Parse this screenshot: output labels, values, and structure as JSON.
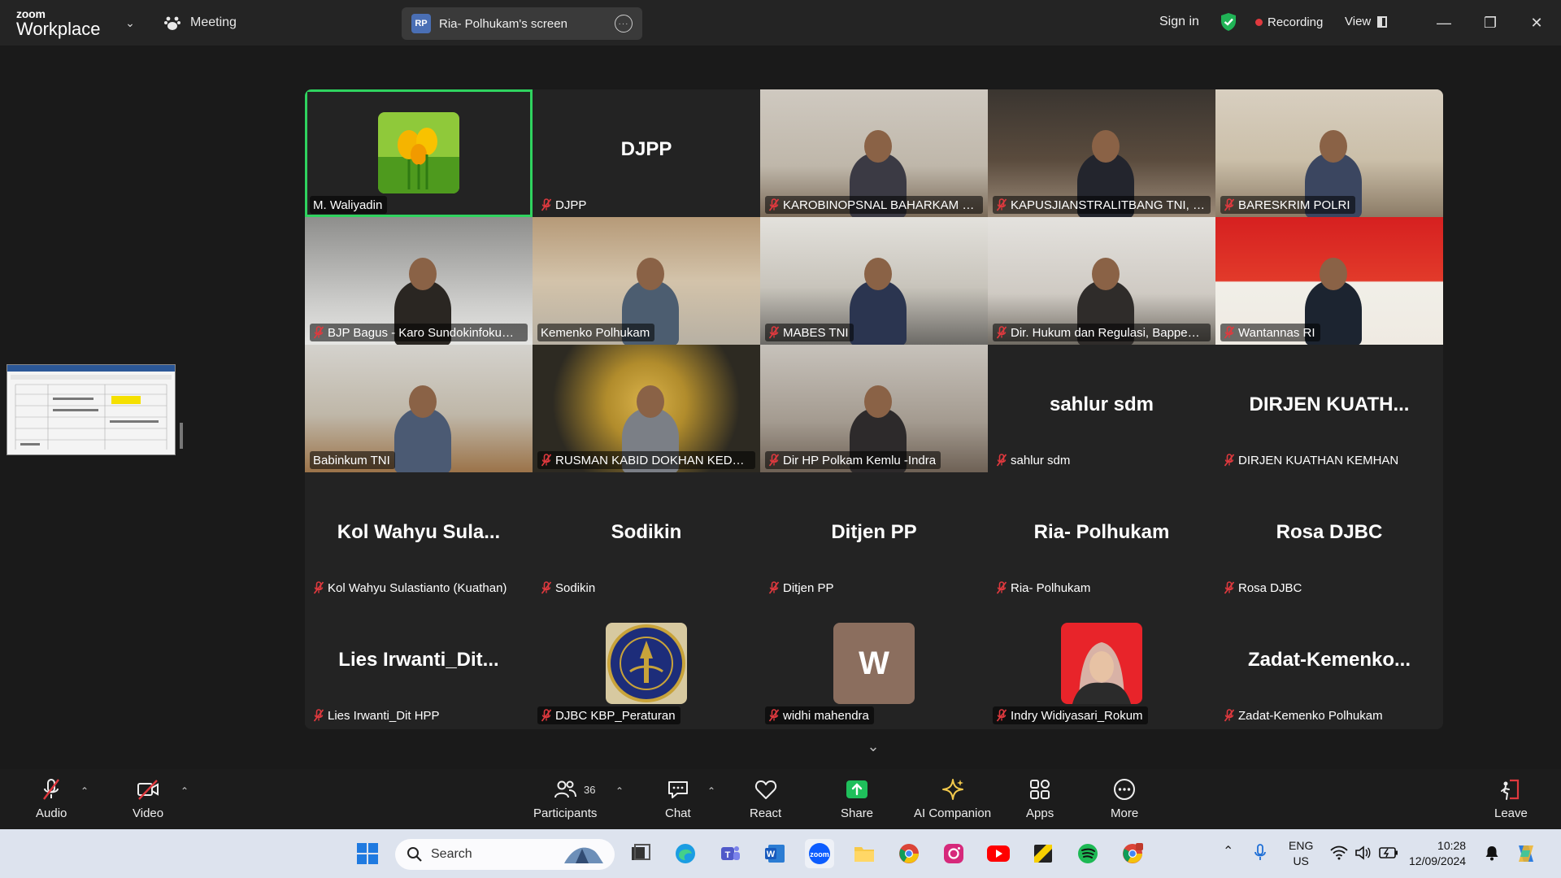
{
  "app": {
    "brand_top": "zoom",
    "brand_bottom": "Workplace",
    "meeting_label": "Meeting",
    "screen_share_badge": "RP",
    "screen_share_label": "Ria- Polhukam's screen",
    "sign_in": "Sign in",
    "recording": "Recording",
    "view": "View"
  },
  "participants": [
    {
      "name": "M. Waliyadin",
      "display": "",
      "type": "avatar-image",
      "muted": false,
      "active": true
    },
    {
      "name": "DJPP",
      "display": "DJPP",
      "type": "name",
      "muted": true
    },
    {
      "name": "KAROBINOPSNAL BAHARKAM PO...",
      "display": "",
      "type": "video",
      "muted": true
    },
    {
      "name": "KAPUSJIANSTRALITBANG TNI, Ma...",
      "display": "",
      "type": "video",
      "muted": true
    },
    {
      "name": "BARESKRIM POLRI",
      "display": "",
      "type": "video",
      "muted": true
    },
    {
      "name": "BJP Bagus - Karo Sundokinfokum ...",
      "display": "",
      "type": "video",
      "muted": true
    },
    {
      "name": "Kemenko Polhukam",
      "display": "",
      "type": "video",
      "muted": false
    },
    {
      "name": "MABES TNI",
      "display": "",
      "type": "video",
      "muted": true
    },
    {
      "name": "Dir. Hukum dan Regulasi, Bappena...",
      "display": "",
      "type": "video",
      "muted": true
    },
    {
      "name": "Wantannas RI",
      "display": "",
      "type": "video",
      "muted": true
    },
    {
      "name": "Babinkum TNI",
      "display": "",
      "type": "video",
      "muted": false
    },
    {
      "name": "RUSMAN KABID DOKHAN KEDEP...",
      "display": "",
      "type": "video",
      "muted": true
    },
    {
      "name": "Dir HP Polkam Kemlu -Indra",
      "display": "",
      "type": "video",
      "muted": true
    },
    {
      "name": "sahlur sdm",
      "display": "sahlur sdm",
      "type": "name",
      "muted": true
    },
    {
      "name": "DIRJEN KUATHAN KEMHAN",
      "display": "DIRJEN  KUATH...",
      "type": "name",
      "muted": true
    },
    {
      "name": "Kol Wahyu Sulastianto (Kuathan)",
      "display": "Kol  Wahyu  Sula...",
      "type": "name",
      "muted": true
    },
    {
      "name": "Sodikin",
      "display": "Sodikin",
      "type": "name",
      "muted": true
    },
    {
      "name": "Ditjen PP",
      "display": "Ditjen PP",
      "type": "name",
      "muted": true
    },
    {
      "name": "Ria- Polhukam",
      "display": "Ria- Polhukam",
      "type": "name",
      "muted": true
    },
    {
      "name": "Rosa DJBC",
      "display": "Rosa DJBC",
      "type": "name",
      "muted": true
    },
    {
      "name": "Lies Irwanti_Dit HPP",
      "display": "Lies  Irwanti_Dit...",
      "type": "name",
      "muted": true
    },
    {
      "name": "DJBC KBP_Peraturan",
      "display": "",
      "type": "avatar-logo",
      "muted": true
    },
    {
      "name": "widhi mahendra",
      "display": "W",
      "type": "avatar-letter",
      "muted": true
    },
    {
      "name": "Indry Widiyasari_Rokum",
      "display": "",
      "type": "avatar-photo",
      "muted": true
    },
    {
      "name": "Zadat-Kemenko Polhukam",
      "display": "Zadat-Kemenko...",
      "type": "name",
      "muted": true
    }
  ],
  "toolbar": {
    "audio": "Audio",
    "video": "Video",
    "participants": "Participants",
    "participants_count": "36",
    "chat": "Chat",
    "react": "React",
    "share": "Share",
    "ai_companion": "AI Companion",
    "apps": "Apps",
    "more": "More",
    "leave": "Leave"
  },
  "taskbar": {
    "search_placeholder": "Search",
    "lang_top": "ENG",
    "lang_bottom": "US",
    "time": "10:28",
    "date": "12/09/2024"
  },
  "colors": {
    "active_speaker": "#2fd35f",
    "recording_dot": "#e0393e",
    "share_green": "#1fbf5b",
    "muted_red": "#e0393e"
  }
}
